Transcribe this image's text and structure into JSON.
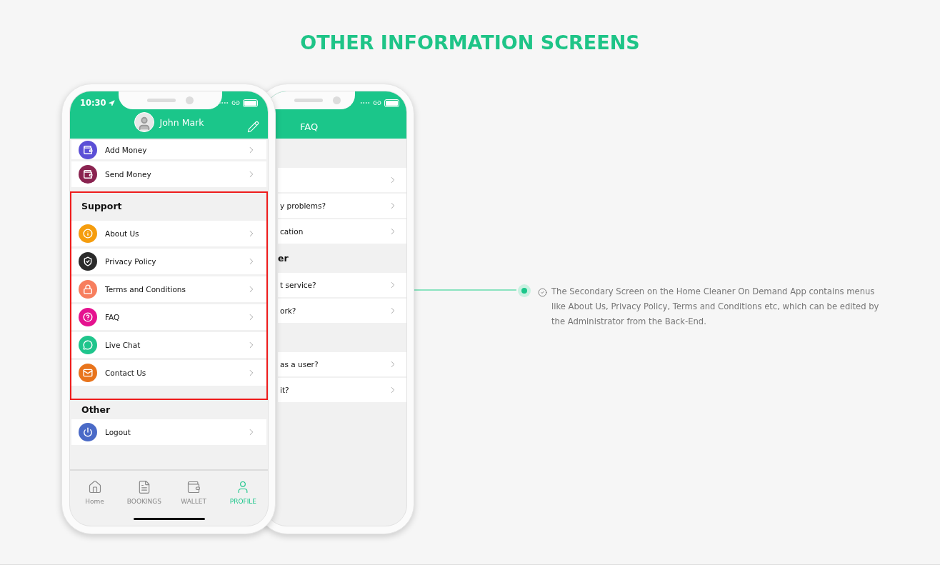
{
  "title": "OTHER INFORMATION SCREENS",
  "front_phone": {
    "time": "10:30",
    "user_name": "John Mark",
    "sections": [
      {
        "highlighted": false,
        "items": [
          {
            "label": "Add Money",
            "color": "#5b4fd6"
          },
          {
            "label": "Send Money",
            "color": "#8a2350"
          }
        ]
      },
      {
        "heading": "Support",
        "highlighted": true,
        "items": [
          {
            "label": "About Us",
            "color": "#f59d0e"
          },
          {
            "label": "Privacy Policy",
            "color": "#2b2b2b"
          },
          {
            "label": "Terms and Conditions",
            "color": "#f77e5e"
          },
          {
            "label": "FAQ",
            "color": "#e5128f"
          },
          {
            "label": "Live Chat",
            "color": "#1fc58c"
          },
          {
            "label": "Contact Us",
            "color": "#e8741c"
          }
        ]
      },
      {
        "heading": "Other",
        "highlighted": false,
        "items": [
          {
            "label": "Logout",
            "color": "#4a6ac7"
          }
        ]
      }
    ],
    "tabs": [
      {
        "label": "Home",
        "selected": false
      },
      {
        "label": "BOOKINGS",
        "selected": false
      },
      {
        "label": "WALLET",
        "selected": false
      },
      {
        "label": "PROFILE",
        "selected": true
      }
    ]
  },
  "back_phone": {
    "title": "FAQ",
    "sections": [
      {
        "rows": [
          {
            "kind": "blank"
          },
          {
            "kind": "text",
            "question": "y problems?"
          },
          {
            "kind": "text",
            "question": "cation"
          }
        ]
      },
      {
        "heading": "er",
        "rows": [
          {
            "kind": "text",
            "question": "t service?"
          },
          {
            "kind": "text",
            "question": "ork?"
          }
        ]
      },
      {
        "rows": [
          {
            "kind": "text",
            "question": "as a user?"
          },
          {
            "kind": "text",
            "question": "it?"
          }
        ]
      }
    ]
  },
  "description": "The Secondary Screen on the Home Cleaner On Demand App contains menus like About Us, Privacy Policy, Terms and Conditions etc, which can be edited by the Administrator from the Back-End."
}
